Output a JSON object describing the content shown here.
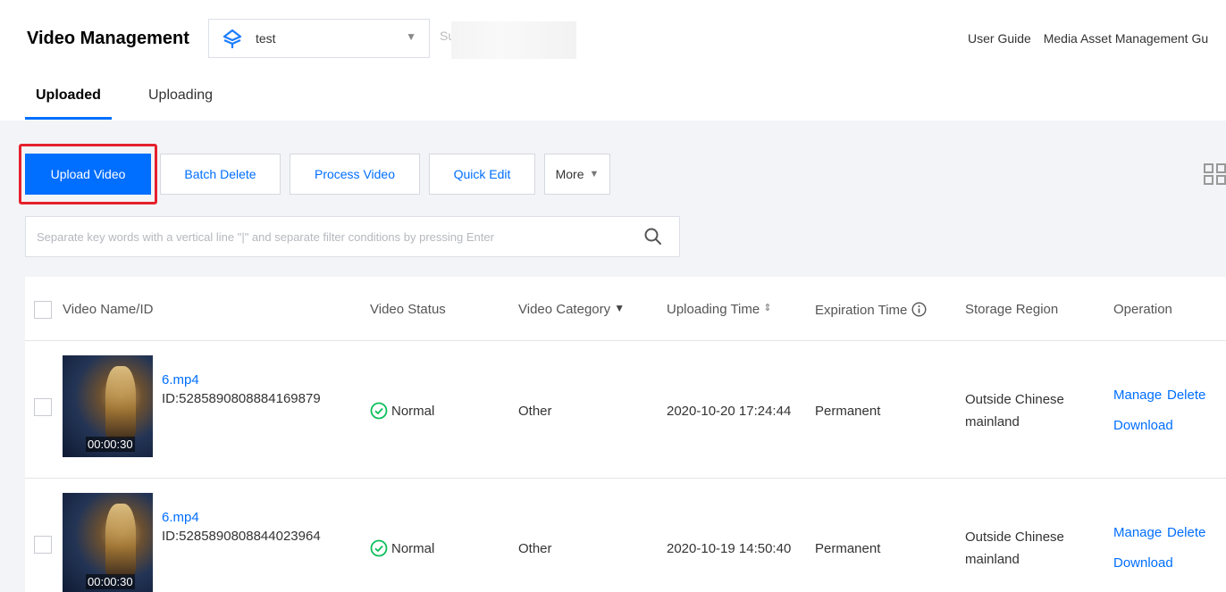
{
  "header": {
    "title": "Video Management",
    "app_name": "test",
    "subapp_text": "Su",
    "links": [
      "User Guide",
      "Media Asset Management Gu"
    ]
  },
  "tabs": [
    {
      "label": "Uploaded",
      "active": true
    },
    {
      "label": "Uploading",
      "active": false
    }
  ],
  "toolbar": {
    "upload": "Upload Video",
    "batch_delete": "Batch Delete",
    "process": "Process Video",
    "quick_edit": "Quick Edit",
    "more": "More"
  },
  "search": {
    "placeholder": "Separate key words with a vertical line \"|\" and separate filter conditions by pressing Enter",
    "value": ""
  },
  "table": {
    "columns": [
      "Video Name/ID",
      "Video Status",
      "Video Category",
      "Uploading Time",
      "Expiration Time",
      "Storage Region",
      "Operation"
    ],
    "rows": [
      {
        "name": "6.mp4",
        "id": "ID:5285890808884169879",
        "duration": "00:00:30",
        "status": "Normal",
        "category": "Other",
        "upload_time": "2020-10-20 17:24:44",
        "expiration": "Permanent",
        "region_line1": "Outside Chinese",
        "region_line2": "mainland",
        "ops": {
          "manage": "Manage",
          "delete": "Delete",
          "download": "Download"
        }
      },
      {
        "name": "6.mp4",
        "id": "ID:5285890808844023964",
        "duration": "00:00:30",
        "status": "Normal",
        "category": "Other",
        "upload_time": "2020-10-19 14:50:40",
        "expiration": "Permanent",
        "region_line1": "Outside Chinese",
        "region_line2": "mainland",
        "ops": {
          "manage": "Manage",
          "delete": "Delete",
          "download": "Download"
        }
      }
    ]
  },
  "colors": {
    "accent": "#006eff",
    "highlight": "#e5212d",
    "success": "#0abf5b"
  }
}
